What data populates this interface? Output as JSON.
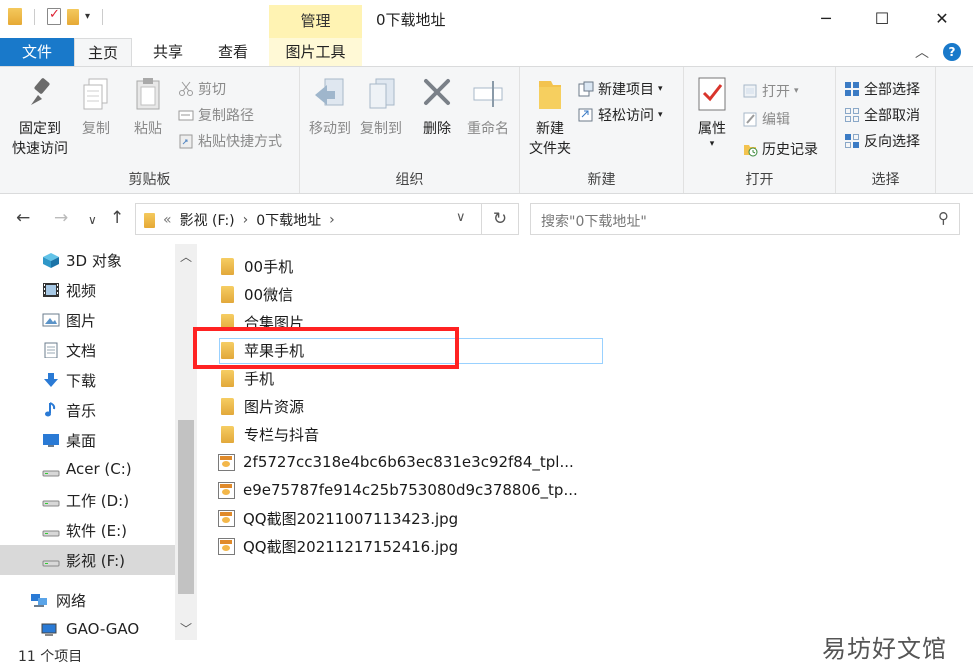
{
  "titlebar": {
    "manage_tab": "管理",
    "window_title": "0下载地址",
    "minimize": "─",
    "maximize": "☐",
    "close": "✕"
  },
  "tabs": {
    "file": "文件",
    "home": "主页",
    "share": "共享",
    "view": "查看",
    "picture_tools": "图片工具"
  },
  "ribbon": {
    "clipboard": {
      "pin": "固定到\n快速访问",
      "pin_l1": "固定到",
      "pin_l2": "快速访问",
      "copy": "复制",
      "paste": "粘贴",
      "cut": "剪切",
      "copy_path": "复制路径",
      "paste_shortcut": "粘贴快捷方式",
      "label": "剪贴板"
    },
    "organize": {
      "move_to": "移动到",
      "copy_to": "复制到",
      "delete": "删除",
      "rename": "重命名",
      "label": "组织"
    },
    "new": {
      "new_folder_l1": "新建",
      "new_folder_l2": "文件夹",
      "new_item": "新建项目",
      "easy_access": "轻松访问",
      "label": "新建"
    },
    "open": {
      "properties": "属性",
      "open": "打开",
      "edit": "编辑",
      "history": "历史记录",
      "label": "打开"
    },
    "select": {
      "select_all": "全部选择",
      "select_none": "全部取消",
      "invert": "反向选择",
      "label": "选择"
    }
  },
  "address": {
    "drive": "影视 (F:)",
    "folder": "0下载地址",
    "search_placeholder": "搜索\"0下载地址\""
  },
  "nav_pane": [
    {
      "label": "3D 对象",
      "icon": "cube-icon"
    },
    {
      "label": "视频",
      "icon": "video-icon"
    },
    {
      "label": "图片",
      "icon": "pictures-icon"
    },
    {
      "label": "文档",
      "icon": "documents-icon"
    },
    {
      "label": "下载",
      "icon": "download-icon"
    },
    {
      "label": "音乐",
      "icon": "music-icon"
    },
    {
      "label": "桌面",
      "icon": "desktop-icon"
    },
    {
      "label": "Acer (C:)",
      "icon": "drive-icon"
    },
    {
      "label": "工作 (D:)",
      "icon": "drive-icon"
    },
    {
      "label": "软件 (E:)",
      "icon": "drive-icon"
    },
    {
      "label": "影视 (F:)",
      "icon": "drive-icon",
      "selected": true
    },
    {
      "label": "网络",
      "icon": "network-icon"
    },
    {
      "label": "GAO-GAO",
      "icon": "computer-icon"
    }
  ],
  "files": [
    {
      "name": "00手机",
      "type": "folder"
    },
    {
      "name": "00微信",
      "type": "folder"
    },
    {
      "name": "合集图片",
      "type": "folder"
    },
    {
      "name": "苹果手机",
      "type": "folder",
      "focused": true
    },
    {
      "name": "手机",
      "type": "folder"
    },
    {
      "name": "图片资源",
      "type": "folder"
    },
    {
      "name": "专栏与抖音",
      "type": "folder"
    },
    {
      "name": "2f5727cc318e4bc6b63ec831e3c92f84_tpl...",
      "type": "image"
    },
    {
      "name": "e9e75787fe914c25b753080d9c378806_tp...",
      "type": "image"
    },
    {
      "name": "QQ截图20211007113423.jpg",
      "type": "image"
    },
    {
      "name": "QQ截图20211217152416.jpg",
      "type": "image"
    }
  ],
  "status": {
    "count": "11 个项目"
  },
  "watermark": "易坊好文馆",
  "colors": {
    "accent": "#1979ca",
    "manage_tab": "#fff3b3",
    "highlight": "#ff2222"
  }
}
